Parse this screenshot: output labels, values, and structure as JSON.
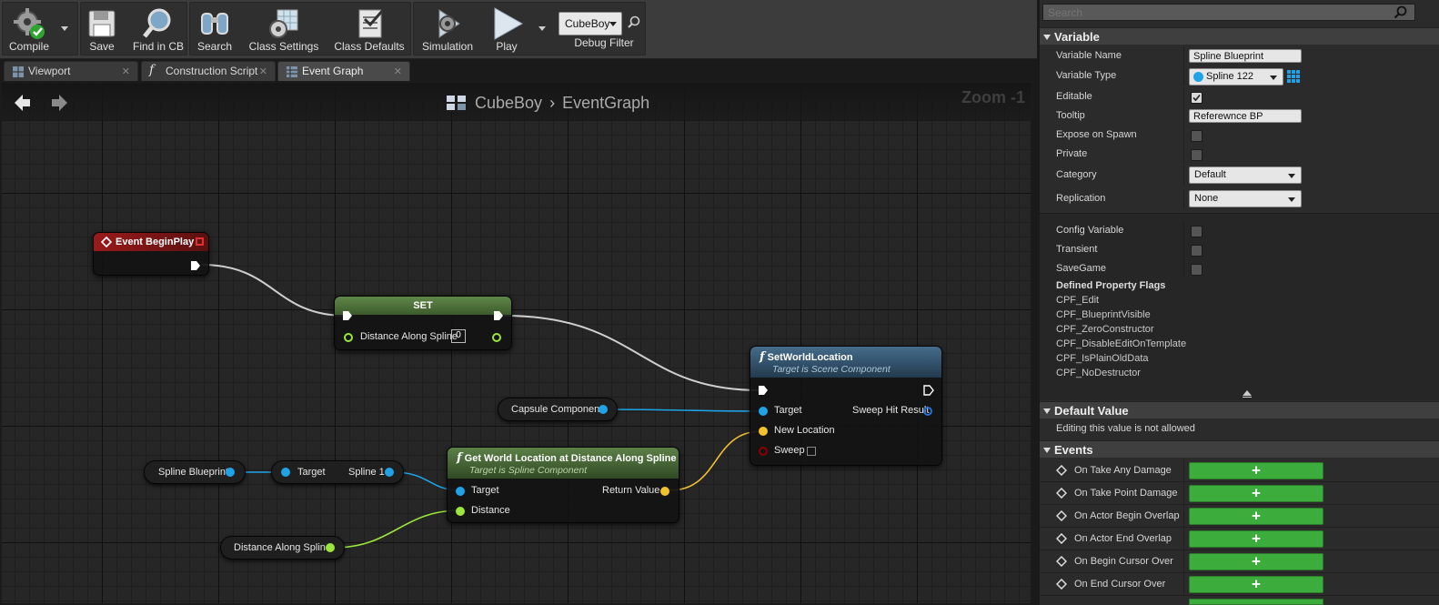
{
  "toolbar": {
    "compile": "Compile",
    "save": "Save",
    "find_in_cb": "Find in CB",
    "search": "Search",
    "class_settings": "Class Settings",
    "class_defaults": "Class Defaults",
    "simulation": "Simulation",
    "play": "Play",
    "debug_object": "CubeBoy",
    "debug_filter": "Debug Filter"
  },
  "tabs": [
    {
      "label": "Viewport"
    },
    {
      "label": "Construction Script"
    },
    {
      "label": "Event Graph"
    }
  ],
  "graph": {
    "breadcrumb_blueprint": "CubeBoy",
    "breadcrumb_graph": "EventGraph",
    "zoom": "Zoom -1",
    "nodes": {
      "begin_play": {
        "title": "Event BeginPlay"
      },
      "set": {
        "title": "SET",
        "pin": "Distance Along Spline",
        "value": "0"
      },
      "set_world_location": {
        "title": "SetWorldLocation",
        "subtitle": "Target is Scene Component",
        "pin_target": "Target",
        "pin_new_location": "New Location",
        "pin_sweep": "Sweep",
        "pin_sweep_hit": "Sweep Hit Result"
      },
      "capsule": {
        "label": "Capsule Component"
      },
      "spline_blueprint": {
        "label": "Spline Blueprint"
      },
      "get_spline1": {
        "target": "Target",
        "output": "Spline 1"
      },
      "get_world_loc": {
        "title": "Get World Location at Distance Along Spline",
        "subtitle": "Target is Spline Component",
        "pin_target": "Target",
        "pin_distance": "Distance",
        "pin_return": "Return Value"
      },
      "distance_var": {
        "label": "Distance Along Spline"
      }
    }
  },
  "details": {
    "search_placeholder": "Search",
    "variable_section": "Variable",
    "variable_name_label": "Variable Name",
    "variable_name_value": "Spline Blueprint",
    "variable_type_label": "Variable Type",
    "variable_type_value": "Spline 122",
    "editable_label": "Editable",
    "tooltip_label": "Tooltip",
    "tooltip_value": "Referewnce BP",
    "expose_label": "Expose on Spawn",
    "private_label": "Private",
    "category_label": "Category",
    "category_value": "Default",
    "replication_label": "Replication",
    "replication_value": "None",
    "config_label": "Config Variable",
    "transient_label": "Transient",
    "savegame_label": "SaveGame",
    "flags_title": "Defined Property Flags",
    "flags": [
      "CPF_Edit",
      "CPF_BlueprintVisible",
      "CPF_ZeroConstructor",
      "CPF_DisableEditOnTemplate",
      "CPF_IsPlainOldData",
      "CPF_NoDestructor"
    ],
    "default_value_section": "Default Value",
    "default_value_note": "Editing this value is not allowed",
    "events_section": "Events",
    "events": [
      "On Take Any Damage",
      "On Take Point Damage",
      "On Actor Begin Overlap",
      "On Actor End Overlap",
      "On Begin Cursor Over",
      "On End Cursor Over"
    ],
    "add_symbol": "+"
  },
  "colors": {
    "exec_wire": "#cfcfcf",
    "object_pin": "#1fa3e6",
    "vector_pin": "#f2c12e",
    "float_pin": "#9be53c",
    "bool_pin": "#8b0000",
    "event_header": "#8a1616",
    "function_header": "#34556e",
    "variable_set_header": "#4e6e3a",
    "add_button": "#3cad3c"
  },
  "icons": [
    "compile-icon",
    "save-icon",
    "find-icon",
    "binoculars-icon",
    "class-settings-icon",
    "class-defaults-icon",
    "simulation-icon",
    "play-icon",
    "search-icon",
    "back-arrow-icon",
    "forward-arrow-icon",
    "blueprint-icon",
    "grid-icon",
    "event-diamond-icon"
  ]
}
